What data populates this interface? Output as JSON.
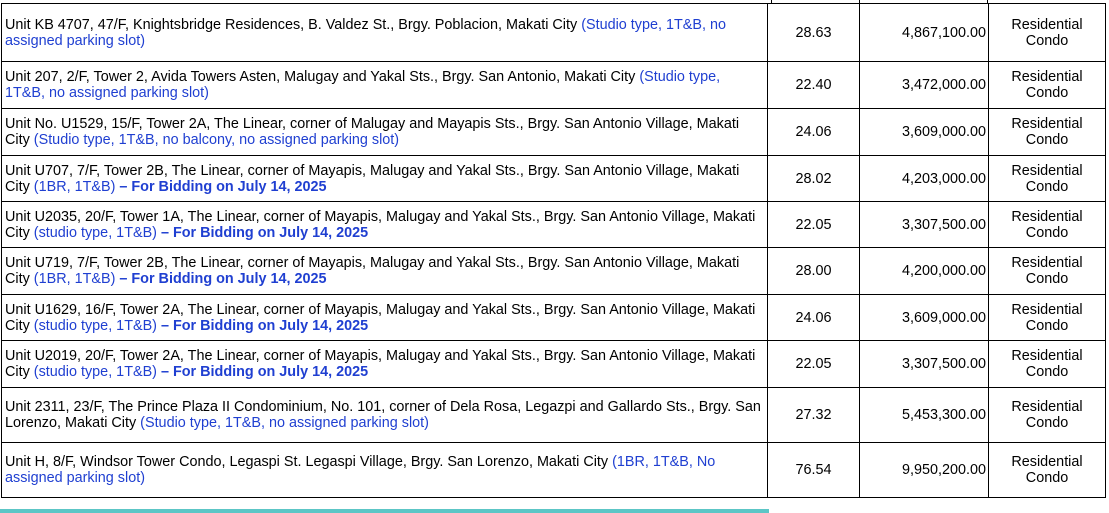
{
  "rows": [
    {
      "desc": "Unit KB 4707, 47/F, Knightsbridge Residences, B. Valdez St., Brgy. Poblacion, Makati City",
      "note": "(Studio type, 1T&B, no assigned parking slot)",
      "bid": "",
      "area": "28.63",
      "price": "4,867,100.00",
      "type_line1": "Residential",
      "type_line2": "Condo",
      "height": 58
    },
    {
      "desc": "Unit 207, 2/F, Tower 2, Avida Towers Asten, Malugay and Yakal Sts., Brgy. San Antonio, Makati City",
      "note": "(Studio type, 1T&B, no assigned parking slot)",
      "bid": "",
      "area": "22.40",
      "price": "3,472,000.00",
      "type_line1": "Residential",
      "type_line2": "Condo",
      "height": 47
    },
    {
      "desc": "Unit No. U1529, 15/F, Tower 2A, The Linear, corner of Malugay and Mayapis Sts., Brgy. San Antonio Village, Makati City",
      "note": "(Studio type, 1T&B, no balcony, no assigned parking slot)",
      "bid": "",
      "area": "24.06",
      "price": "3,609,000.00",
      "type_line1": "Residential",
      "type_line2": "Condo",
      "height": 47
    },
    {
      "desc": "Unit U707, 7/F, Tower 2B, The Linear, corner of Mayapis, Malugay and Yakal Sts., Brgy. San Antonio Village, Makati City",
      "note": "(1BR, 1T&B)",
      "bid": "– For Bidding on July 14, 2025",
      "area": "28.02",
      "price": "4,203,000.00",
      "type_line1": "Residential",
      "type_line2": "Condo",
      "height": 46
    },
    {
      "desc": "Unit U2035, 20/F, Tower 1A, The Linear, corner of Mayapis, Malugay and Yakal Sts., Brgy. San Antonio Village, Makati City",
      "note": "(studio type, 1T&B)",
      "bid": "– For Bidding on July 14, 2025",
      "area": "22.05",
      "price": "3,307,500.00",
      "type_line1": "Residential",
      "type_line2": "Condo",
      "height": 46
    },
    {
      "desc": "Unit U719, 7/F, Tower 2B, The Linear, corner of Mayapis, Malugay and Yakal Sts., Brgy. San Antonio Village, Makati City",
      "note": "(1BR, 1T&B)",
      "bid": "– For Bidding on July 14, 2025",
      "area": "28.00",
      "price": "4,200,000.00",
      "type_line1": "Residential",
      "type_line2": "Condo",
      "height": 47
    },
    {
      "desc": "Unit U1629, 16/F, Tower 2A, The Linear, corner of Mayapis, Malugay and Yakal Sts., Brgy. San Antonio Village, Makati City",
      "note": "(studio type, 1T&B)",
      "bid": "– For Bidding on July 14, 2025",
      "area": "24.06",
      "price": "3,609,000.00",
      "type_line1": "Residential",
      "type_line2": "Condo",
      "height": 46
    },
    {
      "desc": "Unit U2019, 20/F, Tower 2A, The Linear, corner of Mayapis, Malugay and Yakal Sts., Brgy. San Antonio Village, Makati City",
      "note": "(studio type, 1T&B)",
      "bid": "– For Bidding on July 14, 2025",
      "area": "22.05",
      "price": "3,307,500.00",
      "type_line1": "Residential",
      "type_line2": "Condo",
      "height": 47
    },
    {
      "desc": "Unit 2311, 23/F, The Prince Plaza II Condominium, No. 101, corner of Dela Rosa, Legazpi and Gallardo Sts., Brgy. San Lorenzo, Makati City",
      "note": "(Studio type, 1T&B, no assigned parking slot)",
      "bid": "",
      "area": "27.32",
      "price": "5,453,300.00",
      "type_line1": "Residential",
      "type_line2": "Condo",
      "height": 55
    },
    {
      "desc": "Unit H, 8/F, Windsor Tower Condo, Legaspi St. Legaspi Village, Brgy. San Lorenzo, Makati City",
      "note": "(1BR, 1T&B, No assigned parking slot)",
      "bid": "",
      "area": "76.54",
      "price": "9,950,200.00",
      "type_line1": "Residential",
      "type_line2": "Condo",
      "height": 55
    }
  ]
}
